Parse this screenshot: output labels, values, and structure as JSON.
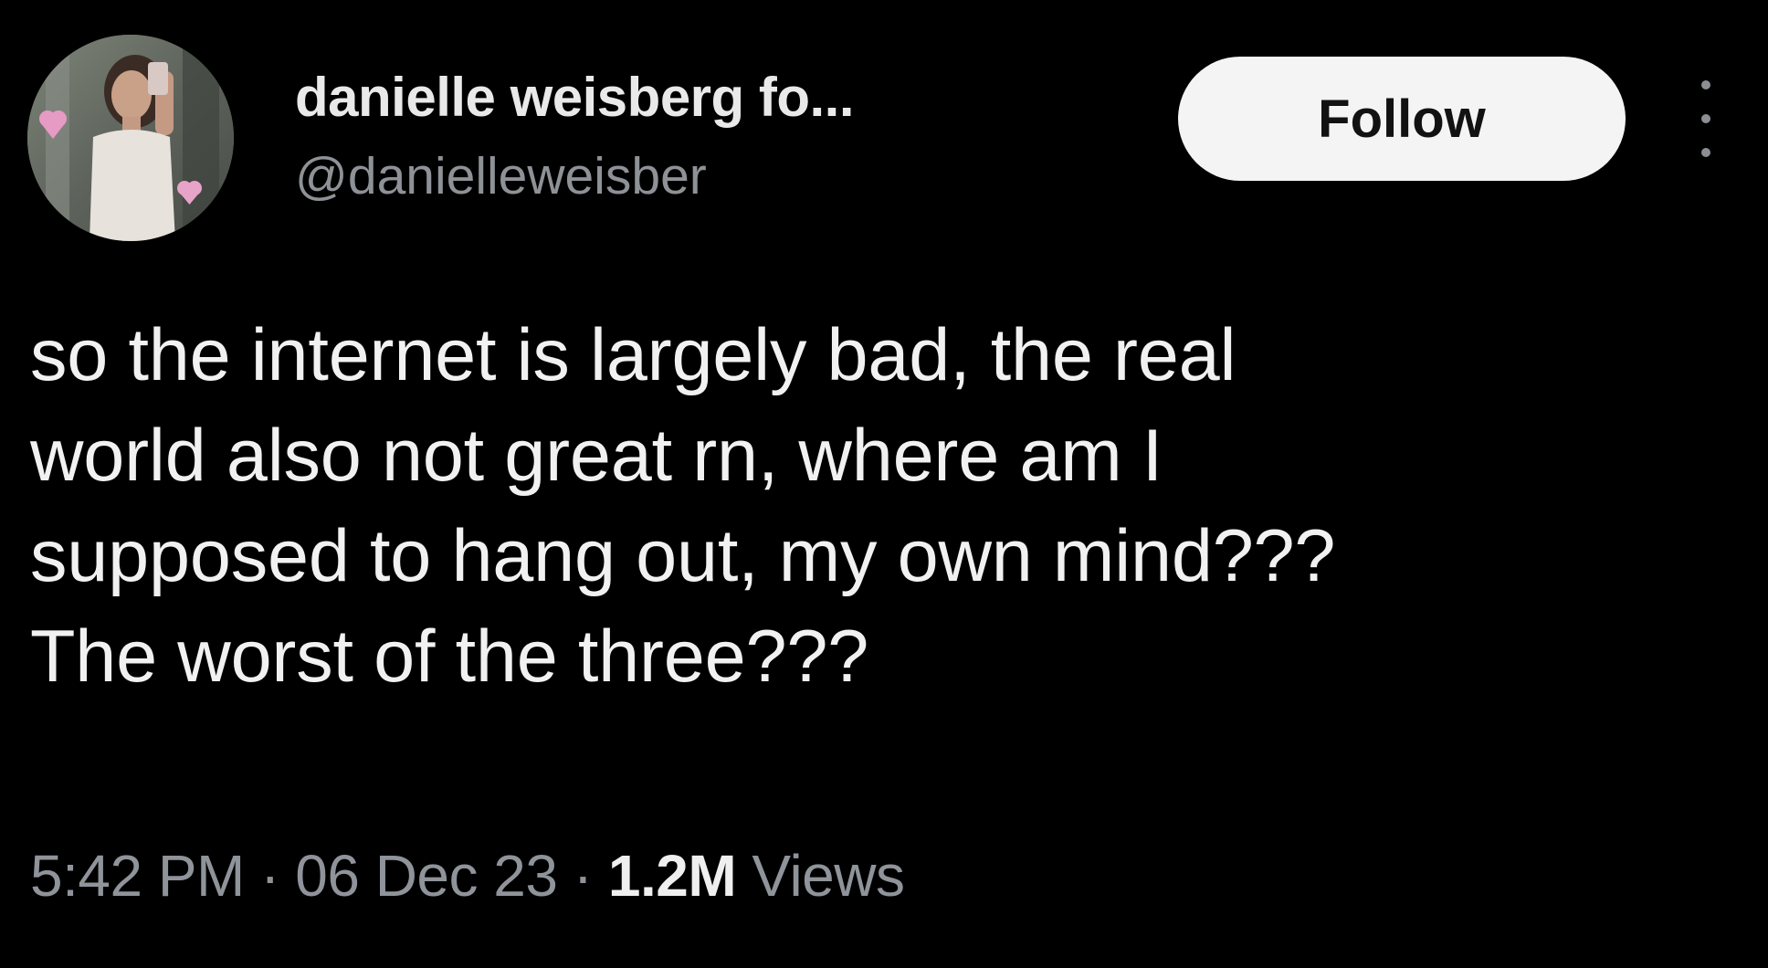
{
  "tweet": {
    "author": {
      "display_name": "danielle weisberg fo...",
      "handle": "@danielleweisber"
    },
    "follow_label": "Follow",
    "text_lines": [
      "so the internet is largely bad, the real",
      "world also not great rn, where am I",
      "supposed to hang out, my own mind???",
      "The worst of the three???"
    ],
    "meta": {
      "time": "5:42 PM",
      "separator": "·",
      "date": "06 Dec 23",
      "views_count": "1.2M",
      "views_label": "Views"
    }
  },
  "icons": {
    "more": "more-vertical-icon",
    "avatar": "profile-photo"
  },
  "colors": {
    "background": "#000000",
    "primary_text": "#f1f1f1",
    "secondary_text": "#8f939a",
    "follow_button_bg": "#f4f4f4",
    "follow_button_text": "#121212"
  }
}
